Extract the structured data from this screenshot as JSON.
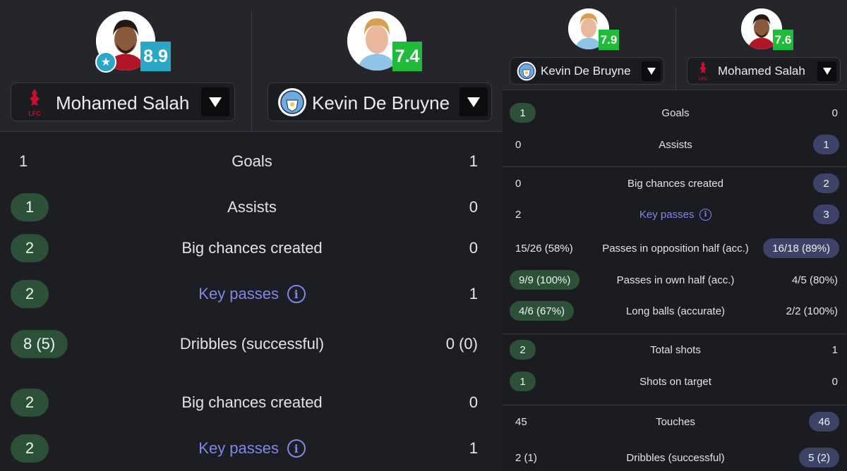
{
  "left": {
    "player1": {
      "name": "Mohamed Salah",
      "rating": "8.9",
      "club_crest_text": "LFC"
    },
    "player2": {
      "name": "Kevin De Bruyne",
      "rating": "7.4"
    },
    "rows": [
      {
        "left": "1",
        "label": "Goals",
        "right": "1",
        "highlight": "none",
        "link": false
      },
      {
        "left": "1",
        "label": "Assists",
        "right": "0",
        "highlight": "left",
        "link": false
      },
      {
        "left": "2",
        "label": "Big chances created",
        "right": "0",
        "highlight": "left",
        "link": false
      },
      {
        "left": "2",
        "label": "Key passes",
        "right": "1",
        "highlight": "left",
        "link": true
      },
      {
        "left": "8 (5)",
        "label": "Dribbles (successful)",
        "right": "0 (0)",
        "highlight": "left",
        "link": false
      },
      {
        "left": "2",
        "label": "Big chances created",
        "right": "0",
        "highlight": "left",
        "link": false
      },
      {
        "left": "2",
        "label": "Key passes",
        "right": "1",
        "highlight": "left",
        "link": true
      }
    ]
  },
  "right": {
    "player1": {
      "name": "Kevin De Bruyne",
      "rating": "7.9"
    },
    "player2": {
      "name": "Mohamed Salah",
      "rating": "7.6",
      "club_crest_text": "LFC"
    },
    "rows": [
      {
        "left": "1",
        "label": "Goals",
        "right": "0",
        "highlight": "left",
        "link": false
      },
      {
        "left": "0",
        "label": "Assists",
        "right": "1",
        "highlight": "right",
        "link": false
      },
      {
        "left": "0",
        "label": "Big chances created",
        "right": "2",
        "highlight": "right",
        "link": false
      },
      {
        "left": "2",
        "label": "Key passes",
        "right": "3",
        "highlight": "right",
        "link": true
      },
      {
        "left": "15/26 (58%)",
        "label": "Passes in opposition half (acc.)",
        "right": "16/18 (89%)",
        "highlight": "right",
        "link": false
      },
      {
        "left": "9/9 (100%)",
        "label": "Passes in own half (acc.)",
        "right": "4/5 (80%)",
        "highlight": "left",
        "link": false
      },
      {
        "left": "4/6 (67%)",
        "label": "Long balls (accurate)",
        "right": "2/2 (100%)",
        "highlight": "left",
        "link": false
      },
      {
        "left": "2",
        "label": "Total shots",
        "right": "1",
        "highlight": "left",
        "link": false
      },
      {
        "left": "1",
        "label": "Shots on target",
        "right": "0",
        "highlight": "left",
        "link": false
      },
      {
        "left": "45",
        "label": "Touches",
        "right": "46",
        "highlight": "right",
        "link": false
      },
      {
        "left": "2 (1)",
        "label": "Dribbles (successful)",
        "right": "5 (2)",
        "highlight": "right",
        "link": false
      }
    ]
  },
  "colors": {
    "background": "#1b1c21",
    "header_background": "#25262c",
    "left_highlight": "#2d5138",
    "right_highlight": "#3d4268",
    "link": "#7f87e8",
    "rating_blue": "#2aa7c6",
    "rating_green": "#1fbb3b",
    "liverpool_red": "#c8102e",
    "city_blue": "#6cabdd"
  },
  "icons": {
    "dropdown": "triangle-down-icon",
    "info": "info-icon",
    "star": "star-icon",
    "liverpool": "liverpool-crest-icon",
    "city": "manchester-city-crest-icon"
  }
}
